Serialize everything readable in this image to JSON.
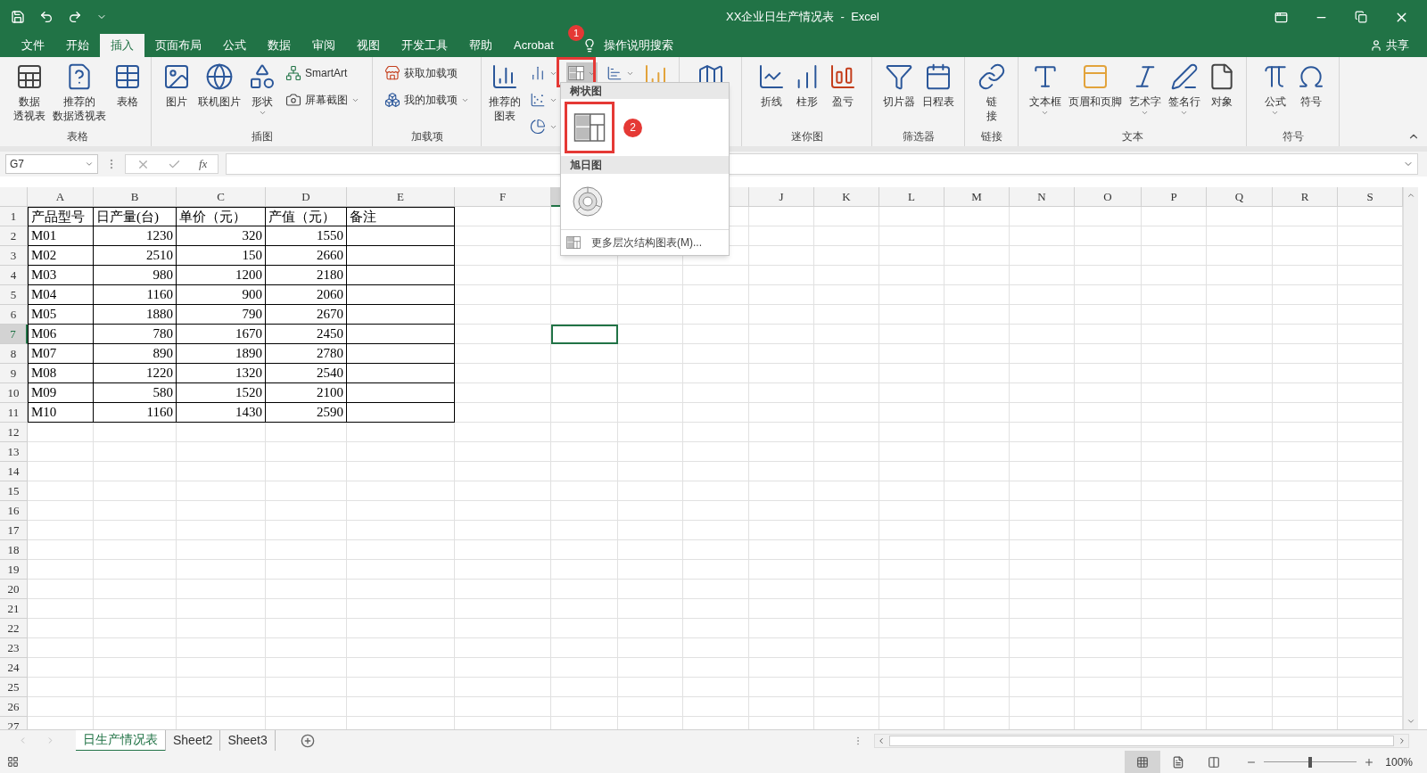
{
  "title_bar": {
    "title": "XX企业日生产情况表  -  Excel"
  },
  "menu_tabs": [
    {
      "label": "文件",
      "selected": false
    },
    {
      "label": "开始",
      "selected": false
    },
    {
      "label": "插入",
      "selected": true
    },
    {
      "label": "页面布局",
      "selected": false
    },
    {
      "label": "公式",
      "selected": false
    },
    {
      "label": "数据",
      "selected": false
    },
    {
      "label": "审阅",
      "selected": false
    },
    {
      "label": "视图",
      "selected": false
    },
    {
      "label": "开发工具",
      "selected": false
    },
    {
      "label": "帮助",
      "selected": false
    },
    {
      "label": "Acrobat",
      "selected": false
    }
  ],
  "tell_me": "操作说明搜索",
  "share": "共享",
  "ribbon": {
    "groups": [
      {
        "label": "表格",
        "items": [
          {
            "kind": "large",
            "label": [
              "数据",
              "透视表"
            ]
          },
          {
            "kind": "large",
            "label": [
              "推荐的",
              "数据透视表"
            ]
          },
          {
            "kind": "large",
            "label": "表格"
          }
        ]
      },
      {
        "label": "插图",
        "items": [
          {
            "kind": "large",
            "label": "图片"
          },
          {
            "kind": "large",
            "label": "联机图片"
          },
          {
            "kind": "large",
            "label": "形状",
            "menu": true
          },
          {
            "kind": "stack",
            "items": [
              {
                "label": "SmartArt"
              },
              {
                "label": "屏幕截图",
                "menu": true
              }
            ]
          }
        ]
      },
      {
        "label": "加载项",
        "items": [
          {
            "kind": "stack",
            "items": [
              {
                "label": "获取加载项"
              },
              {
                "label": "我的加载项",
                "menu": true
              }
            ]
          }
        ]
      },
      {
        "items": [
          {
            "kind": "large",
            "label": [
              "推荐的",
              "图表"
            ]
          },
          {
            "kind": "stack",
            "items": [
              {
                "menu": true
              },
              {
                "menu": true
              },
              {
                "menu": true
              }
            ]
          },
          {
            "kind": "stack",
            "items": [
              {
                "menu": true,
                "pressed": true
              }
            ]
          },
          {
            "kind": "stack",
            "items": [
              {
                "menu": true
              }
            ]
          },
          {
            "kind": "large"
          }
        ]
      },
      {
        "items": [
          {
            "kind": "large"
          }
        ]
      },
      {
        "label": "迷你图",
        "items": [
          {
            "kind": "large",
            "label": "折线"
          },
          {
            "kind": "large",
            "label": "柱形"
          },
          {
            "kind": "large",
            "label": "盈亏"
          }
        ]
      },
      {
        "label": "筛选器",
        "items": [
          {
            "kind": "large",
            "label": "切片器"
          },
          {
            "kind": "large",
            "label": "日程表"
          }
        ]
      },
      {
        "label": "链接",
        "items": [
          {
            "kind": "large",
            "label": [
              "链",
              "接"
            ]
          }
        ]
      },
      {
        "label": "文本",
        "items": [
          {
            "kind": "large",
            "label": "文本框",
            "menu": true
          },
          {
            "kind": "large",
            "label": "页眉和页脚"
          },
          {
            "kind": "large",
            "label": "艺术字",
            "menu": true
          },
          {
            "kind": "large",
            "label": "签名行",
            "menu": true
          },
          {
            "kind": "large",
            "label": "对象"
          }
        ]
      },
      {
        "label": "符号",
        "items": [
          {
            "kind": "large",
            "label": "公式",
            "menu": true
          },
          {
            "kind": "large",
            "label": "符号"
          }
        ]
      }
    ]
  },
  "annotations": [
    {
      "label": "1"
    },
    {
      "label": "2"
    }
  ],
  "dropdown": {
    "sections": [
      {
        "header": "树状图"
      },
      {
        "header": "旭日图"
      }
    ],
    "footer": "更多层次结构图表(M)..."
  },
  "formula_bar": {
    "name_box": "G7",
    "fx": "fx"
  },
  "sheet": {
    "columns": [
      {
        "label": "A",
        "selected": false
      },
      {
        "label": "B",
        "selected": false
      },
      {
        "label": "C",
        "selected": false
      },
      {
        "label": "D",
        "selected": false
      },
      {
        "label": "E",
        "selected": false
      },
      {
        "label": "F",
        "selected": false
      },
      {
        "selected": true
      },
      {},
      {},
      {
        "label": "J",
        "selected": false
      },
      {
        "label": "K",
        "selected": false
      },
      {
        "label": "L",
        "selected": false
      },
      {
        "label": "M",
        "selected": false
      },
      {
        "label": "N",
        "selected": false
      },
      {
        "label": "O",
        "selected": false
      },
      {
        "label": "P",
        "selected": false
      },
      {
        "label": "Q",
        "selected": false
      },
      {
        "label": "R",
        "selected": false
      },
      {
        "label": "S",
        "selected": false
      }
    ],
    "rows": [
      {
        "label": "1",
        "selected": false,
        "kind": "header",
        "cells": [
          "产品型号",
          "日产量(台)",
          "单价（元）",
          "产值（元）",
          "备注"
        ]
      },
      {
        "label": "2",
        "selected": false,
        "kind": "data",
        "cells": [
          "M01",
          "1230",
          "320",
          "1550",
          ""
        ]
      },
      {
        "label": "3",
        "selected": false,
        "kind": "data",
        "cells": [
          "M02",
          "2510",
          "150",
          "2660",
          ""
        ]
      },
      {
        "label": "4",
        "selected": false,
        "kind": "data",
        "cells": [
          "M03",
          "980",
          "1200",
          "2180",
          ""
        ]
      },
      {
        "label": "5",
        "selected": false,
        "kind": "data",
        "cells": [
          "M04",
          "1160",
          "900",
          "2060",
          ""
        ]
      },
      {
        "label": "6",
        "selected": false,
        "kind": "data",
        "cells": [
          "M05",
          "1880",
          "790",
          "2670",
          ""
        ]
      },
      {
        "label": "7",
        "selected": true,
        "kind": "data",
        "cells": [
          "M06",
          "780",
          "1670",
          "2450",
          ""
        ]
      },
      {
        "label": "8",
        "selected": false,
        "kind": "data",
        "cells": [
          "M07",
          "890",
          "1890",
          "2780",
          ""
        ]
      },
      {
        "label": "9",
        "selected": false,
        "kind": "data",
        "cells": [
          "M08",
          "1220",
          "1320",
          "2540",
          ""
        ]
      },
      {
        "label": "10",
        "selected": false,
        "kind": "data",
        "cells": [
          "M09",
          "580",
          "1520",
          "2100",
          ""
        ]
      },
      {
        "label": "11",
        "selected": false,
        "kind": "data",
        "cells": [
          "M10",
          "1160",
          "1430",
          "2590",
          ""
        ]
      },
      {
        "label": "12",
        "selected": false
      },
      {
        "label": "13",
        "selected": false
      },
      {
        "label": "14",
        "selected": false
      },
      {
        "label": "15",
        "selected": false
      },
      {
        "label": "16",
        "selected": false
      },
      {
        "label": "17",
        "selected": false
      },
      {
        "label": "18",
        "selected": false
      },
      {
        "label": "19",
        "selected": false
      },
      {
        "label": "20",
        "selected": false
      },
      {
        "label": "21",
        "selected": false
      },
      {
        "label": "22",
        "selected": false
      },
      {
        "label": "23",
        "selected": false
      },
      {
        "label": "24",
        "selected": false
      },
      {
        "label": "25",
        "selected": false
      },
      {
        "label": "26",
        "selected": false
      },
      {
        "label": "27",
        "selected": false
      }
    ]
  },
  "sheet_tabs": [
    {
      "label": "日生产情况表",
      "selected": true
    },
    {
      "label": "Sheet2",
      "selected": false
    },
    {
      "label": "Sheet3",
      "selected": false
    }
  ],
  "status_bar": {
    "views": [
      {
        "selected": true
      },
      {
        "selected": false
      },
      {
        "selected": false
      }
    ],
    "zoom": {
      "level": 0.5,
      "reading": "100%"
    }
  }
}
